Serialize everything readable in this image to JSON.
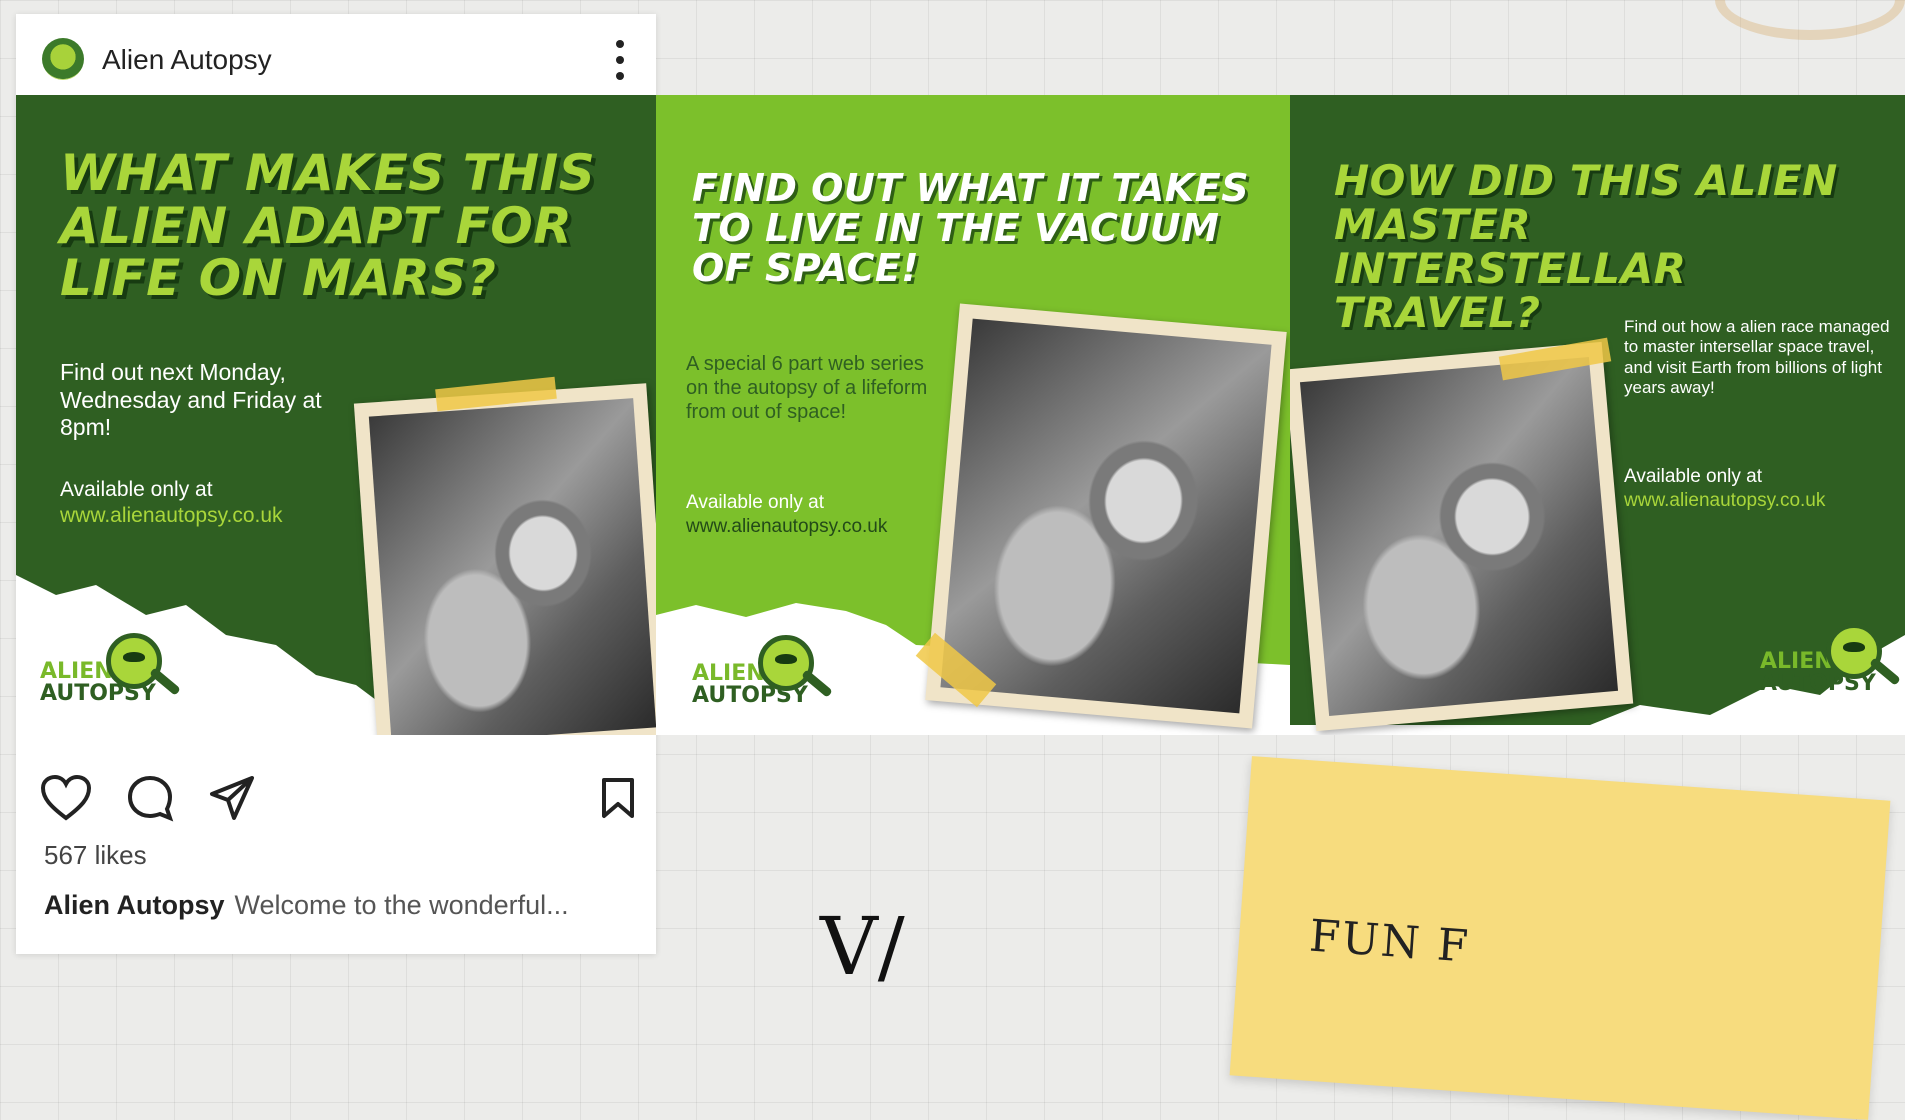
{
  "post": {
    "username": "Alien Autopsy",
    "likes": "567 likes",
    "caption_user": "Alien Autopsy",
    "caption_text": "Welcome to the wonderful..."
  },
  "slides": [
    {
      "headline": "What makes this alien adapt for life on Mars?",
      "body": "Find out next Monday, Wednesday and Friday at 8pm!",
      "available": "Available only at",
      "url": "www.alienautopsy.co.uk"
    },
    {
      "headline": "Find out what it takes to live in the vacuum of space!",
      "body": "A special 6 part web series on the autopsy of a lifeform from out of space!",
      "available": "Available only at",
      "url": "www.alienautopsy.co.uk"
    },
    {
      "headline": "How did this alien master interstellar travel?",
      "body": "Find out how a alien race managed to master intersellar space travel, and visit Earth from billions of light years away!",
      "available": "Available only at",
      "url": "www.alienautopsy.co.uk"
    }
  ],
  "logo": {
    "line1": "ALIEN",
    "line2": "AUTOPSY"
  },
  "icons": [
    "heart-icon",
    "comment-icon",
    "share-icon",
    "bookmark-icon",
    "more-options-icon"
  ],
  "colors": {
    "dark_green": "#2f5f22",
    "lime": "#7cc02b",
    "accent_green": "#a9d63a"
  },
  "sticky_note": {
    "text": "FUN F"
  },
  "scribble": {
    "text": "V/"
  }
}
